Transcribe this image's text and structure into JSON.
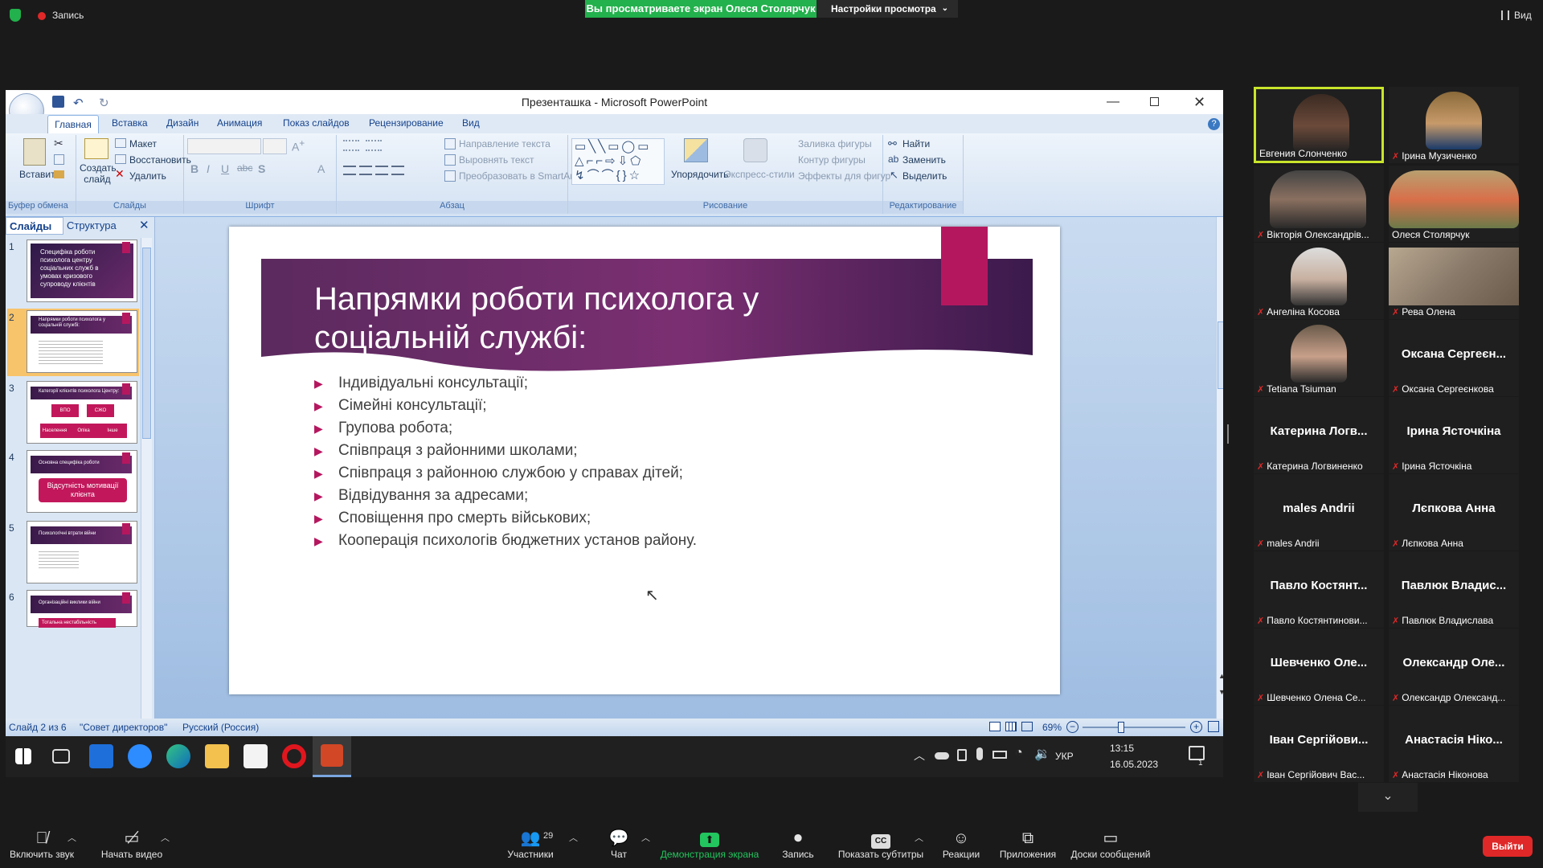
{
  "zoom_top": {
    "record_label": "Запись",
    "share_banner": "Вы просматриваете экран Олеся Столярчук",
    "view_settings": "Настройки просмотра",
    "view_label": "Вид"
  },
  "ppt": {
    "window_title": "Презенташка - Microsoft PowerPoint",
    "tabs": [
      "Главная",
      "Вставка",
      "Дизайн",
      "Анимация",
      "Показ слайдов",
      "Рецензирование",
      "Вид"
    ],
    "ribbon": {
      "clipboard": {
        "paste": "Вставить",
        "label": "Буфер обмена"
      },
      "slides": {
        "new_slide": "Создать слайд",
        "layout": "Макет",
        "reset": "Восстановить",
        "delete": "Удалить",
        "label": "Слайды"
      },
      "font": {
        "label": "Шрифт"
      },
      "paragraph": {
        "text_direction": "Направление текста",
        "align_text": "Выровнять текст",
        "smartart": "Преобразовать в SmartArt",
        "label": "Абзац"
      },
      "drawing": {
        "arrange": "Упорядочить",
        "quick_styles": "Экспресс-стили",
        "fill": "Заливка фигуры",
        "outline": "Контур фигуры",
        "effects": "Эффекты для фигур",
        "label": "Рисование"
      },
      "editing": {
        "find": "Найти",
        "replace": "Заменить",
        "select": "Выделить",
        "label": "Редактирование"
      }
    },
    "pane_tabs": {
      "slides": "Слайды",
      "outline": "Структура"
    },
    "thumbs": [
      {
        "num": "1",
        "text": "Специфіка роботи психолога центру соціальних служб в умовах кризового супроводу клієнтів"
      },
      {
        "num": "2",
        "text": "Напрямки роботи психолога у соціальній службі:"
      },
      {
        "num": "3",
        "text": "Категорії клієнтів психолога Центру:",
        "boxes": [
          "ВПО",
          "СЖО",
          "Населення",
          "Опіка",
          "Інше"
        ]
      },
      {
        "num": "4",
        "text": "Основна специфіка роботи",
        "box": "Відсутність мотивації клієнта"
      },
      {
        "num": "5",
        "text": "Психологічні втрати війни"
      },
      {
        "num": "6",
        "text": "Організаційні виклики війни",
        "box": "Тотальна нестабільність"
      }
    ],
    "slide": {
      "title": "Напрямки роботи психолога у соціальній службі:",
      "bullets": [
        "Індивідуальні консультації;",
        "Сімейні консультації;",
        "Групова робота;",
        "Співпраця з районними школами;",
        "Співпраця з районною службою у справах дітей;",
        "Відвідування за адресами;",
        "Сповіщення про смерть військових;",
        "Кооперація психологів бюджетних установ району."
      ]
    },
    "status": {
      "slide_of": "Слайд 2 из 6",
      "theme": "\"Совет директоров\"",
      "language": "Русский (Россия)",
      "zoom": "69%"
    }
  },
  "taskbar": {
    "time": "13:15",
    "date": "16.05.2023",
    "lang": "УКР",
    "notif": "1"
  },
  "participants": [
    {
      "name": "Евгения Слонченко",
      "video": true,
      "active": true
    },
    {
      "name": "Ірина Музиченко",
      "video": true
    },
    {
      "name": "Вікторія Олександрів...",
      "video": true
    },
    {
      "name": "Олеся Столярчук",
      "video": true
    },
    {
      "name": "Ангеліна Косова",
      "video": true
    },
    {
      "name": "Рева Олена",
      "video": true
    },
    {
      "name": "Tetiana Tsiuman",
      "video": true
    },
    {
      "name": "Оксана Сергеєнкова",
      "big": "Оксана Сергеєн..."
    },
    {
      "name": "Катерина Логвиненко",
      "big": "Катерина Логв..."
    },
    {
      "name": "Ірина Ясточкіна",
      "big": "Ірина Ясточкіна"
    },
    {
      "name": "males Andrii",
      "big": "males Andrii"
    },
    {
      "name": "Лєпкова Анна",
      "big": "Лєпкова Анна"
    },
    {
      "name": "Павло Костянтинови...",
      "big": "Павло Костянт..."
    },
    {
      "name": "Павлюк Владислава",
      "big": "Павлюк Владис..."
    },
    {
      "name": "Шевченко Олена Се...",
      "big": "Шевченко Оле..."
    },
    {
      "name": "Олександр Олександ...",
      "big": "Олександр Оле..."
    },
    {
      "name": "Іван Сергійович Вас...",
      "big": "Іван Сергійови..."
    },
    {
      "name": "Анастасія Ніконова",
      "big": "Анастасія Ніко..."
    }
  ],
  "bottom_bar": {
    "mic": "Включить звук",
    "video": "Начать видео",
    "participants": "Участники",
    "participants_count": "29",
    "chat": "Чат",
    "share": "Демонстрация экрана",
    "record": "Запись",
    "captions": "Показать субтитры",
    "reactions": "Реакции",
    "apps": "Приложения",
    "whiteboards": "Доски сообщений",
    "leave": "Выйти"
  }
}
